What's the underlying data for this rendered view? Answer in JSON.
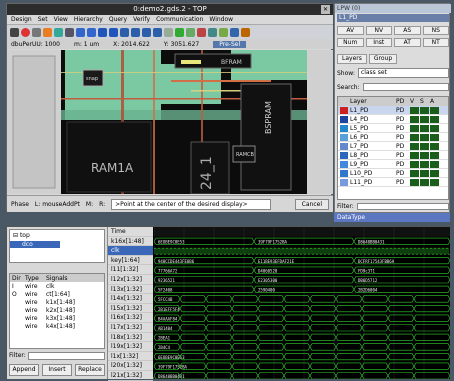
{
  "layout_window": {
    "title": "0:demo2.gds.2 - TOP",
    "menu": [
      "Design",
      "Set",
      "View",
      "Hierarchy",
      "Query",
      "Verify",
      "Communication",
      "Window"
    ],
    "info": {
      "dbu": "dbuPerUU: 1000",
      "unit": "m: 1 um",
      "x": "X: 2014.622",
      "y": "Y: 3051.627",
      "preset": "Pre-Sel"
    },
    "labels": {
      "bfram": "BFRAM",
      "bspram": "BSPRAM",
      "ram1a": "RAM1A",
      "ramcb": "RAMCB",
      "num": "24_1",
      "snap": "snap"
    },
    "status": {
      "phase": "Phase",
      "l": "L: mouseAddPt",
      "m": "M:",
      "r": "R:",
      "message": ">Point at the center of the desired display>",
      "cancel": "Cancel"
    }
  },
  "layer_window": {
    "title": "LPW (0)",
    "selected": "L1_PD",
    "buttons_row1": [
      "AV",
      "NV",
      "AS",
      "NS"
    ],
    "buttons_row2": [
      "Num",
      "Inst",
      "AT",
      "NT"
    ],
    "tabs": [
      "Layers",
      "Group"
    ],
    "show_label": "Show:",
    "show_value": "class set",
    "search_label": "Search:",
    "table_head": [
      "Layer",
      "PD",
      "V",
      "S",
      "A"
    ],
    "layers": [
      {
        "name": "L1_PD",
        "pd": "PD",
        "color": "#cc2020",
        "selected": true
      },
      {
        "name": "L4_PD",
        "pd": "PD",
        "color": "#1a44a0"
      },
      {
        "name": "L5_PD",
        "pd": "PD",
        "color": "#2288cc"
      },
      {
        "name": "L6_PD",
        "pd": "PD",
        "color": "#5aa0d8"
      },
      {
        "name": "L7_PD",
        "pd": "PD",
        "color": "#6688cc"
      },
      {
        "name": "L8_PD",
        "pd": "PD",
        "color": "#2a66bb"
      },
      {
        "name": "L9_PD",
        "pd": "PD",
        "color": "#4488dd"
      },
      {
        "name": "L10_PD",
        "pd": "PD",
        "color": "#3377cc"
      },
      {
        "name": "L11_PD",
        "pd": "PD",
        "color": "#7799dd"
      }
    ],
    "filter_label": "Filter:",
    "datatype": "DataType"
  },
  "waveform": {
    "tree": [
      "top",
      "dco"
    ],
    "sig_head": [
      "Dir",
      "Type",
      "Signals"
    ],
    "signals": [
      {
        "dir": "I",
        "type": "wire",
        "name": "clk"
      },
      {
        "dir": "O",
        "type": "wire",
        "name": "ct[1:64]"
      },
      {
        "dir": "",
        "type": "wire",
        "name": "k1x[1:48]"
      },
      {
        "dir": "",
        "type": "wire",
        "name": "k2x[1:48]"
      },
      {
        "dir": "",
        "type": "wire",
        "name": "k3x[1:48]"
      },
      {
        "dir": "",
        "type": "wire",
        "name": "k4x[1:48]"
      }
    ],
    "filter_label": "Filter:",
    "buttons": [
      "Append",
      "Insert",
      "Replace"
    ],
    "names": [
      "Time",
      "k16x[1:48]",
      "clk",
      "key[1:64]",
      "l11[1:32]",
      "l12x[1:32]",
      "l13x[1:32]",
      "l14x[1:32]",
      "l15x[1:32]",
      "l16x[1:32]",
      "l17x[1:32]",
      "l18x[1:32]",
      "l19x[1:32]",
      "l1x[1:32]",
      "l20x[1:32]",
      "l21x[1:32]"
    ],
    "bus_values": [
      "6EOBE9C8E53",
      "39F79F1752BA",
      "D8648BB0431",
      "948CCDE443FE8B6",
      "E11BE93EFDAF21E",
      "DCFRF17543FBB6A",
      "77766A72",
      "D4060520",
      "FD9c3T1",
      "9236521",
      "E2305300",
      "DB6D5712",
      "5F2408",
      "2590400",
      "2B2D6004",
      "5FCC4B",
      "2B1EFF5F4",
      "B4AAAF84",
      "AB1404",
      "2BEA1",
      "2B4C4"
    ]
  }
}
